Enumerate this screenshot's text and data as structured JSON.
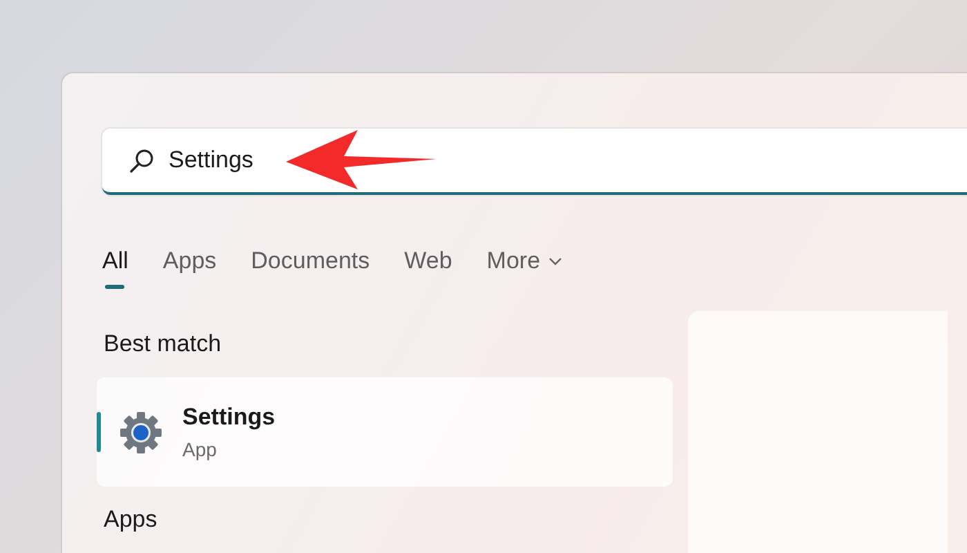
{
  "search": {
    "value": "Settings"
  },
  "tabs": [
    {
      "label": "All",
      "selected": true,
      "kind": "plain"
    },
    {
      "label": "Apps",
      "selected": false,
      "kind": "plain"
    },
    {
      "label": "Documents",
      "selected": false,
      "kind": "plain"
    },
    {
      "label": "Web",
      "selected": false,
      "kind": "plain"
    },
    {
      "label": "More",
      "selected": false,
      "kind": "menu"
    }
  ],
  "best_match": {
    "heading": "Best match",
    "result": {
      "title": "Settings",
      "subtitle": "App",
      "selected": true
    }
  },
  "apps": {
    "heading": "Apps"
  }
}
